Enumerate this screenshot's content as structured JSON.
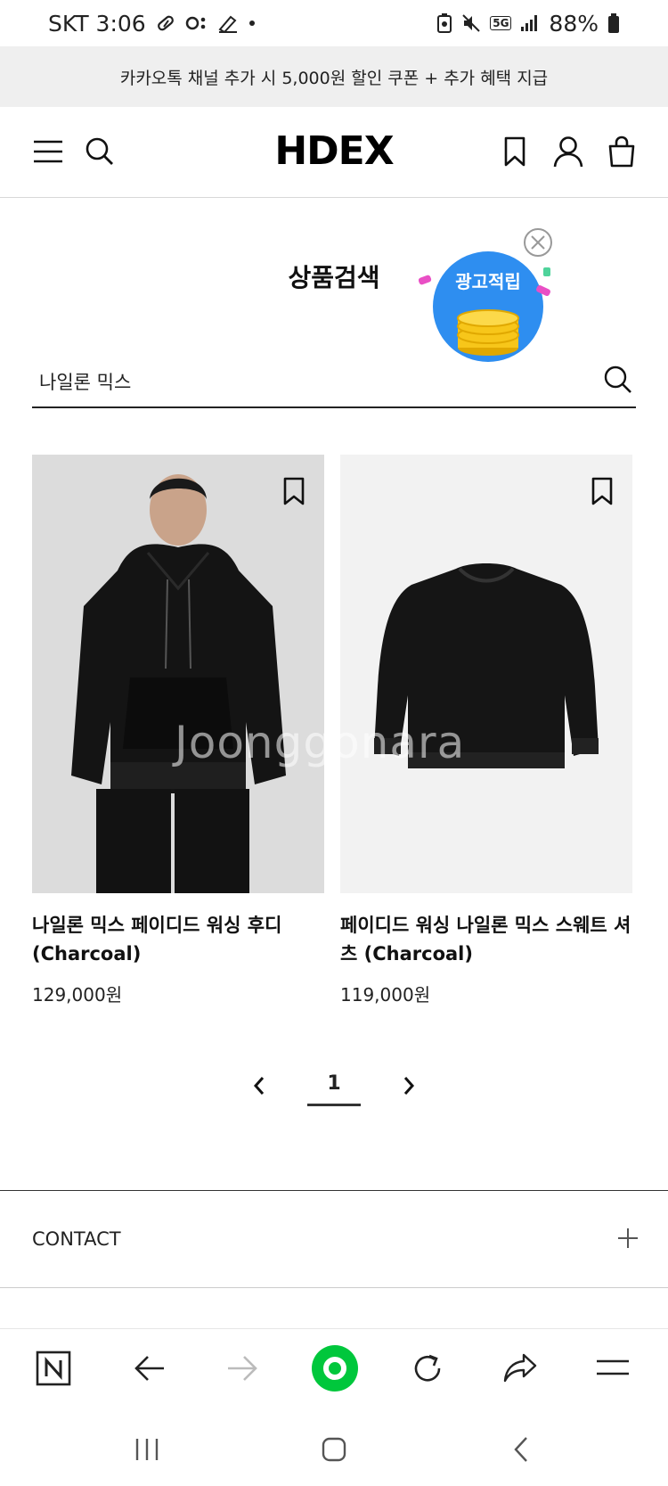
{
  "status_bar": {
    "carrier_time": "SKT 3:06",
    "battery": "88%",
    "network": "5G"
  },
  "promo_banner": {
    "text": "카카오톡 채널 추가 시 5,000원 할인 쿠폰 + 추가 혜택 지급"
  },
  "header": {
    "logo": "HDEX"
  },
  "search": {
    "title": "상품검색",
    "query": "나일론 믹스"
  },
  "ad_badge": {
    "label": "광고적립"
  },
  "products": [
    {
      "name": "나일론 믹스 페이디드 워싱 후디 (Charcoal)",
      "price": "129,000원"
    },
    {
      "name": "페이디드 워싱 나일론 믹스 스웨트 셔츠 (Charcoal)",
      "price": "119,000원"
    }
  ],
  "pagination": {
    "current_page": "1"
  },
  "footer": {
    "contact_label": "CONTACT"
  },
  "watermark": {
    "text": "Joonggonara"
  },
  "colors": {
    "banner_bg": "#efefef",
    "product_bg_left": "#dcdcdc",
    "product_bg_right": "#f2f2f2",
    "browser_accent": "#00c73c",
    "ad_blue": "#2e8ef0",
    "coin_gold": "#f7c61a"
  },
  "icons": {
    "menu": "hamburger-icon",
    "search": "search-icon",
    "bookmark": "bookmark-icon",
    "account": "user-icon",
    "cart": "shopping-bag-icon"
  }
}
